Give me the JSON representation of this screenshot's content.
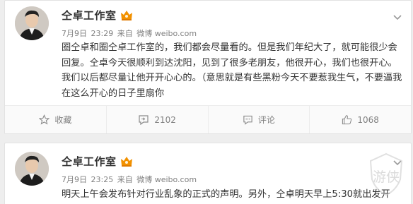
{
  "posts": [
    {
      "user": {
        "name": "仝卓工作室"
      },
      "meta": {
        "date": "7月9日",
        "time": "23:29",
        "source_prefix": "来自",
        "source": "微博 weibo.com"
      },
      "text": "圈仝卓和圈仝卓工作室的，我们都会尽量看的。但是我们年纪大了，就可能很少会回复。仝卓今天很顺利到达沈阳，见到了很多老朋友，他很开心，我们也很开心。我们以后都尽量让他开开心心的。（意思就是有些黑粉今天不要惹我生气，不要逼我在这么开心的日子里扇你",
      "actions": {
        "favorite": "收藏",
        "repost": "2102",
        "comment": "评论",
        "like": "1068"
      }
    },
    {
      "user": {
        "name": "仝卓工作室"
      },
      "meta": {
        "date": "7月9日",
        "time": "23:25",
        "source_prefix": "来自",
        "source": "微博 weibo.com"
      },
      "text": "明天上午会发布针对行业乱象的正式的声明。另外，仝卓明天早上5:30就出发开"
    }
  ],
  "watermark": {
    "text": "游侠"
  },
  "colors": {
    "text": "#333333",
    "meta": "#808080",
    "vip": "#f29100",
    "background": "#eeeeee"
  }
}
